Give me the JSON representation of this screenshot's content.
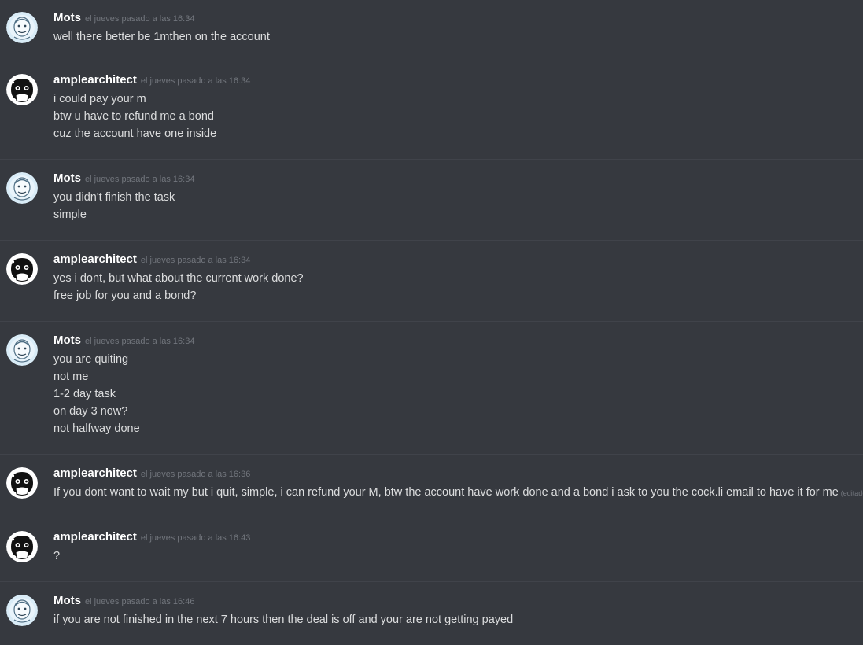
{
  "messages": [
    {
      "author": "Mots",
      "avatar": "mots-avatar-icon",
      "timestamp": "el jueves pasado a las 16:34",
      "lines": [
        "well there better be 1mthen on the account"
      ]
    },
    {
      "author": "amplearchitect",
      "avatar": "amplearchitect-avatar-icon",
      "timestamp": "el jueves pasado a las 16:34",
      "lines": [
        "i could pay your m",
        "btw u have to refund me a bond",
        "cuz the account have one inside"
      ]
    },
    {
      "author": "Mots",
      "avatar": "mots-avatar-icon",
      "timestamp": "el jueves pasado a las 16:34",
      "lines": [
        "you didn't finish the task",
        "simple"
      ]
    },
    {
      "author": "amplearchitect",
      "avatar": "amplearchitect-avatar-icon",
      "timestamp": "el jueves pasado a las 16:34",
      "lines": [
        "yes i dont, but what about the current work done?",
        "free job for you and a bond?"
      ]
    },
    {
      "author": "Mots",
      "avatar": "mots-avatar-icon",
      "timestamp": "el jueves pasado a las 16:34",
      "lines": [
        "you are quiting",
        "not me",
        "1-2 day task",
        "on day 3 now?",
        "not halfway done"
      ]
    },
    {
      "author": "amplearchitect",
      "avatar": "amplearchitect-avatar-icon",
      "timestamp": "el jueves pasado a las 16:36",
      "lines": [
        "If you dont want to wait my but i quit, simple, i can refund your M, btw the account have work done and a bond i ask to you the cock.li email to have it for me"
      ],
      "edited": "(editado)"
    },
    {
      "author": "amplearchitect",
      "avatar": "amplearchitect-avatar-icon",
      "timestamp": "el jueves pasado a las 16:43",
      "lines": [
        "?"
      ]
    },
    {
      "author": "Mots",
      "avatar": "mots-avatar-icon",
      "timestamp": "el jueves pasado a las 16:46",
      "lines": [
        "if you are not finished in the next 7 hours then the deal is off and your are not getting payed"
      ]
    }
  ],
  "colors": {
    "background": "#36393f",
    "divider": "#40434a",
    "username": "#ffffff",
    "message_text": "#dcddde",
    "timestamp": "#72767d"
  }
}
